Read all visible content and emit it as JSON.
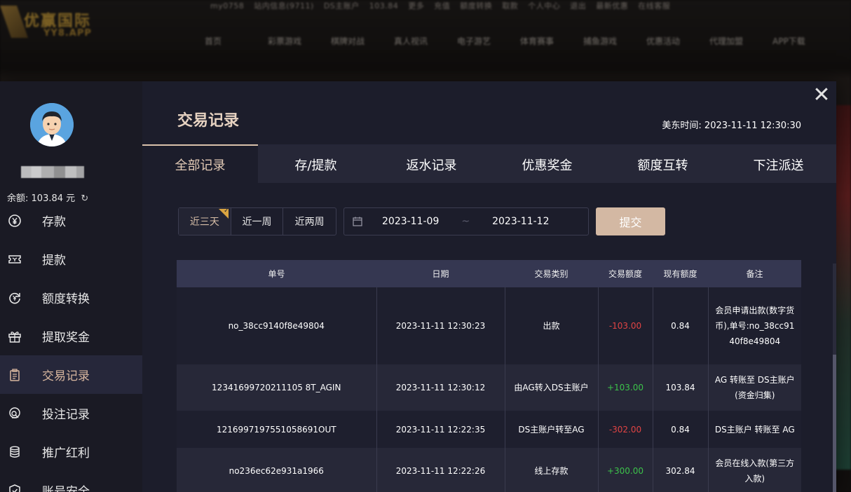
{
  "background": {
    "logo_text": "优赢国际",
    "logo_sub": "YY8.APP",
    "topbar": [
      "my0758",
      "站内信息(9711)",
      "DS主账户",
      "103.84",
      "更多",
      "充值",
      "额度转换",
      "取款",
      "个人中心",
      "退出",
      "最新优惠",
      "在线客服"
    ],
    "nav": [
      "首页",
      "彩票游戏",
      "棋牌对战",
      "真人视讯",
      "电子游艺",
      "体育赛事",
      "捕鱼游戏",
      "优惠活动",
      "代理加盟",
      "APP下载"
    ]
  },
  "sidebar": {
    "balance_label": "余额:",
    "balance_value": "103.84",
    "balance_unit": "元",
    "items": [
      {
        "label": "存款",
        "icon": "yuan-circle-icon"
      },
      {
        "label": "提款",
        "icon": "ticket-icon"
      },
      {
        "label": "额度转换",
        "icon": "exchange-icon"
      },
      {
        "label": "提取奖金",
        "icon": "gift-icon"
      },
      {
        "label": "交易记录",
        "icon": "clipboard-icon",
        "active": true
      },
      {
        "label": "投注记录",
        "icon": "search-doc-icon"
      },
      {
        "label": "推广红利",
        "icon": "coins-icon"
      },
      {
        "label": "账号安全",
        "icon": "shield-icon"
      }
    ]
  },
  "main": {
    "title": "交易记录",
    "time_label": "美东时间:",
    "time_value": "2023-11-11 12:30:30",
    "tabs": [
      "全部记录",
      "存/提款",
      "返水记录",
      "优惠奖金",
      "额度互转",
      "下注派送"
    ],
    "ranges": [
      "近三天",
      "近一周",
      "近两周"
    ],
    "date_start": "2023-11-09",
    "date_sep": "~",
    "date_end": "2023-11-12",
    "submit_label": "提交"
  },
  "table": {
    "headers": [
      "单号",
      "日期",
      "交易类别",
      "交易额度",
      "现有额度",
      "备注"
    ],
    "rows": [
      {
        "id": "no_38cc9140f8e49804",
        "date": "2023-11-11 12:30:23",
        "type": "出款",
        "amount": "-103.00",
        "balance": "0.84",
        "note": "会员申请出款(数字货币),单号:no_38cc9140f8e49804"
      },
      {
        "id": "12341699720211105 8T_AGIN",
        "date": "2023-11-11 12:30:12",
        "type": "由AG转入DS主账户",
        "amount": "+103.00",
        "balance": "103.84",
        "note": "AG 转账至 DS主账户(资金归集)"
      },
      {
        "id": "1216997197551058691OUT",
        "date": "2023-11-11 12:22:35",
        "type": "DS主账户转至AG",
        "amount": "-302.00",
        "balance": "0.84",
        "note": "DS主账户 转账至 AG"
      },
      {
        "id": "no236ec62e931a1966",
        "date": "2023-11-11 12:22:26",
        "type": "线上存款",
        "amount": "+300.00",
        "balance": "302.84",
        "note": "会员在线入款(第三方入款)"
      }
    ]
  },
  "colors": {
    "accent": "#d3b8a3",
    "negative": "#e14444",
    "positive": "#3cc24a",
    "modal_bg": "#1c1d2b",
    "header_bg": "#353751"
  }
}
